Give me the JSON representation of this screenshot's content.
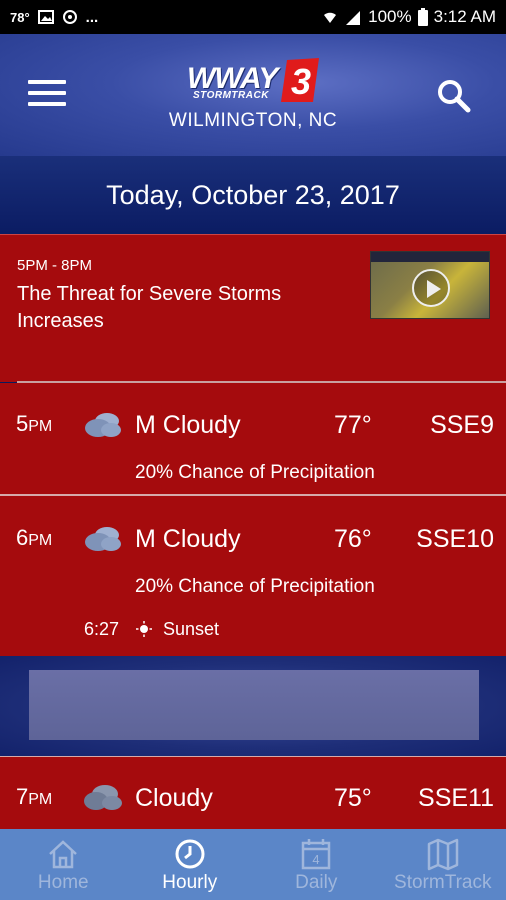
{
  "status_bar": {
    "temperature": "78°",
    "more": "...",
    "battery": "100%",
    "time": "3:12 AM"
  },
  "header": {
    "logo_text": "WWAY",
    "logo_sub": "STORMTRACK",
    "logo_number": "3",
    "city": "WILMINGTON, NC"
  },
  "date_label": "Today, October 23, 2017",
  "story": {
    "time_range": "5PM - 8PM",
    "title": "The Threat for Severe Storms Increases"
  },
  "hours": [
    {
      "hour": "5",
      "ampm": "PM",
      "icon": "partly-cloudy-icon",
      "condition": "M Cloudy",
      "temp": "77°",
      "wind": "SSE9",
      "precip": "20% Chance of Precipitation"
    },
    {
      "hour": "6",
      "ampm": "PM",
      "icon": "partly-cloudy-icon",
      "condition": "M Cloudy",
      "temp": "76°",
      "wind": "SSE10",
      "precip": "20% Chance of Precipitation",
      "event_time": "6:27",
      "event_label": "Sunset"
    },
    {
      "hour": "7",
      "ampm": "PM",
      "icon": "cloudy-icon",
      "condition": "Cloudy",
      "temp": "75°",
      "wind": "SSE11"
    }
  ],
  "nav": [
    {
      "label": "Home",
      "icon": "home-icon",
      "active": false
    },
    {
      "label": "Hourly",
      "icon": "clock-icon",
      "active": true
    },
    {
      "label": "Daily",
      "icon": "calendar-icon",
      "calendar_day": "4",
      "active": false
    },
    {
      "label": "StormTrack",
      "icon": "map-icon",
      "active": false
    }
  ],
  "colors": {
    "header_blue": "#3a4ea6",
    "forecast_red": "#a50b0d",
    "nav_blue": "#5b86c8",
    "nav_inactive": "#9fb6dc"
  }
}
